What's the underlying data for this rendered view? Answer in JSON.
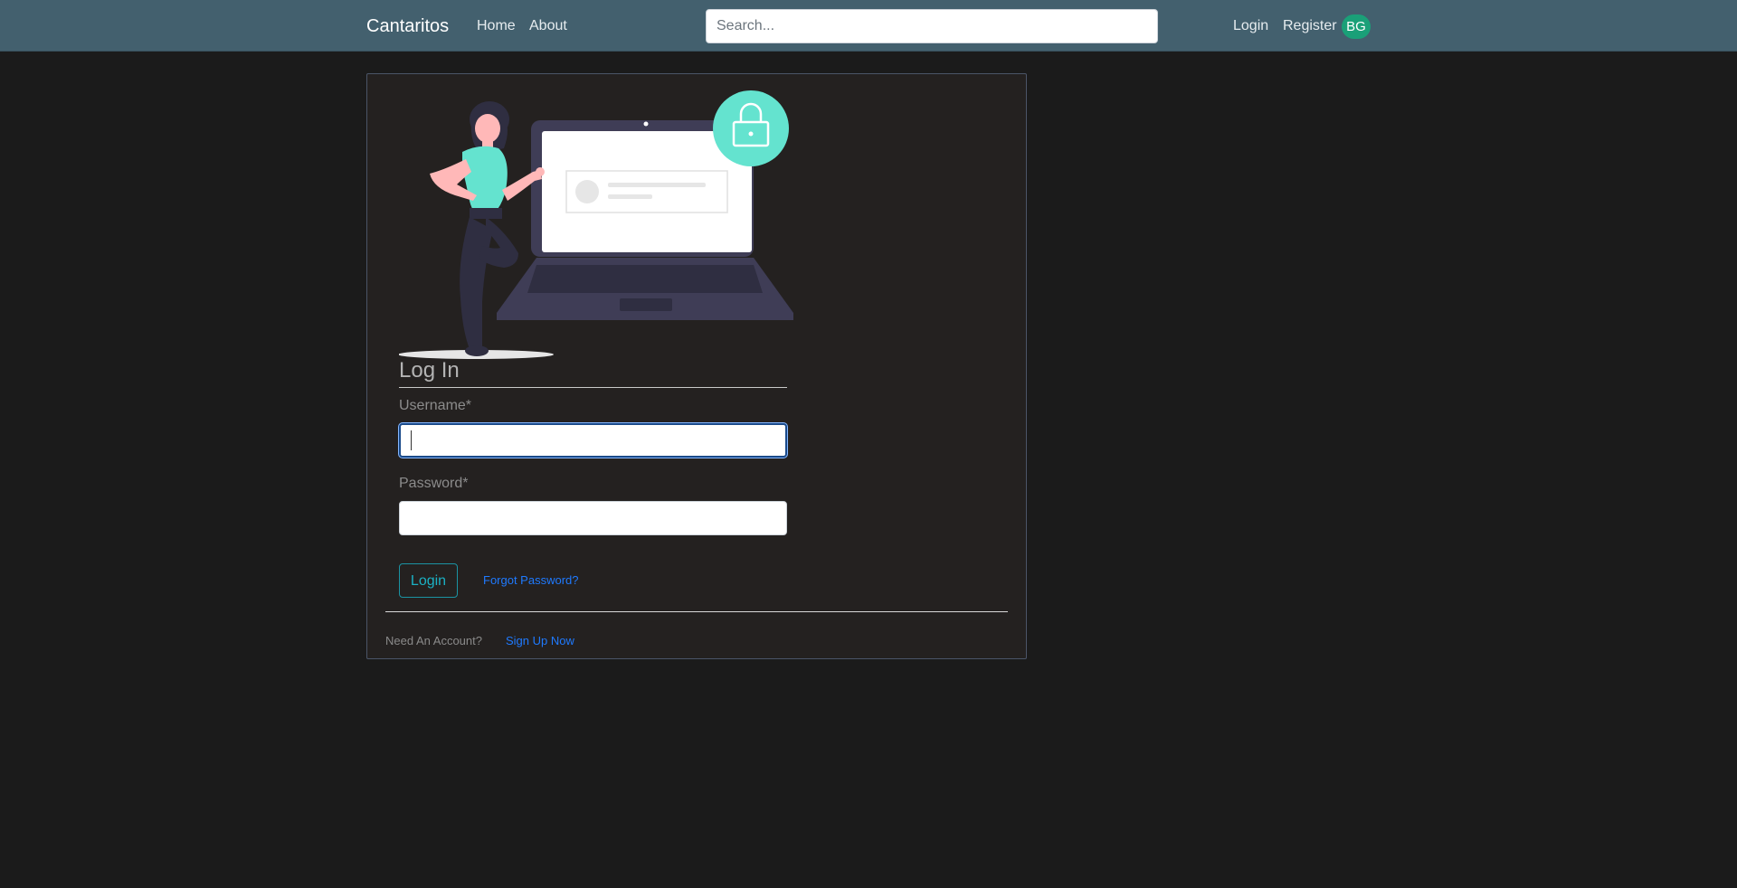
{
  "navbar": {
    "brand": "Cantaritos",
    "links": [
      {
        "label": "Home"
      },
      {
        "label": "About"
      }
    ],
    "search": {
      "placeholder": "Search...",
      "value": ""
    },
    "auth_links": [
      {
        "label": "Login"
      },
      {
        "label": "Register"
      }
    ],
    "avatar_initials": "BG"
  },
  "login_form": {
    "title": "Log In",
    "username_label": "Username*",
    "username_value": "",
    "password_label": "Password*",
    "password_value": "",
    "submit_label": "Login",
    "forgot_label": "Forgot Password?",
    "need_account_text": "Need An Account?",
    "signup_label": "Sign Up Now"
  },
  "colors": {
    "navbar_bg": "#43606e",
    "page_bg": "#1b1b1b",
    "card_bg": "#242120",
    "accent_teal": "#64e3cf",
    "link_blue": "#1f7aff",
    "avatar_bg": "#1aa078"
  },
  "icons": {
    "illustration": "woman-with-laptop-lock-illustration",
    "lock": "lock-icon"
  }
}
